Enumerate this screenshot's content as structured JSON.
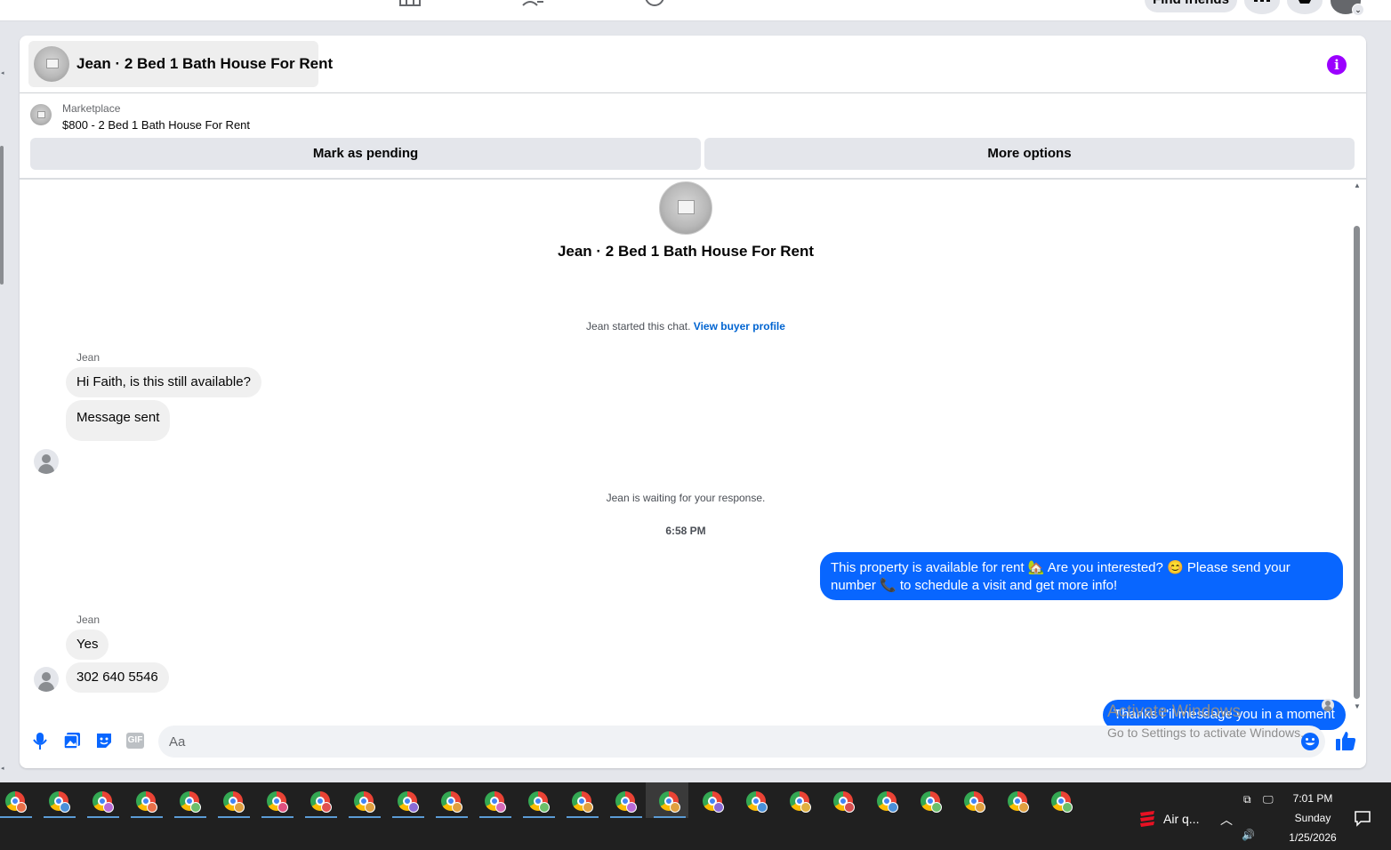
{
  "topbar": {
    "find_friends_label": "Find friends"
  },
  "chat_header": {
    "title": "Jean · 2 Bed 1 Bath House For Rent"
  },
  "listing": {
    "source_label": "Marketplace",
    "summary": "$800 - 2 Bed 1 Bath House For Rent",
    "mark_pending_label": "Mark as pending",
    "more_options_label": "More options"
  },
  "conversation": {
    "title": "Jean · 2 Bed 1 Bath House For Rent",
    "started_text": "Jean started this chat.",
    "view_profile_link": "View buyer profile",
    "sender_1": "Jean",
    "msg_1": "Hi Faith, is this still available?",
    "msg_2": "Message sent",
    "waiting_text": "Jean is waiting for your response.",
    "timestamp": "6:58 PM",
    "out_msg_1": "This property is available for rent 🏡 Are you interested? 😊 Please send your number 📞 to schedule a visit and get more info!",
    "sender_2": "Jean",
    "msg_3": "Yes",
    "msg_4": "302 640 5546",
    "out_msg_2": "Thanks i\"il message you in a moment"
  },
  "composer": {
    "placeholder": "Aa",
    "gif_label": "GIF"
  },
  "watermark": {
    "line1": "Activate Windows",
    "line2": "Go to Settings to activate Windows."
  },
  "taskbar": {
    "weather_label": "Air q...",
    "time": "7:01 PM",
    "day": "Sunday",
    "date": "1/25/2026"
  },
  "colors": {
    "accent_blue": "#0866ff",
    "info_purple": "#9b00ff",
    "link_blue": "#0064d1"
  }
}
